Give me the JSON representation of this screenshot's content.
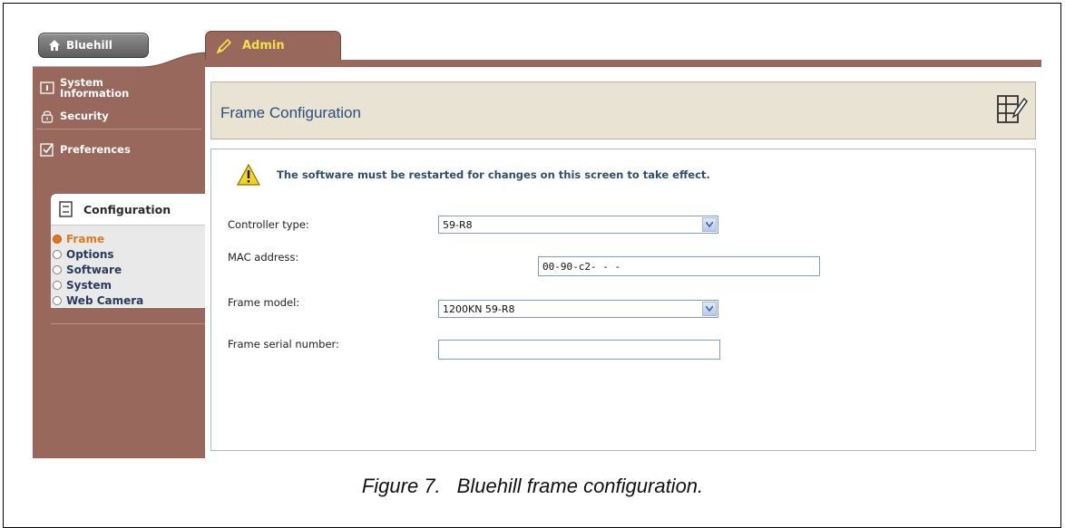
{
  "tabs": {
    "home_label": "Bluehill",
    "admin_label": "Admin"
  },
  "sidebar": {
    "items": [
      {
        "label_line1": "System",
        "label_line2": "Information",
        "icon": "info-icon"
      },
      {
        "label": "Security",
        "icon": "lock-icon"
      },
      {
        "label": "Preferences",
        "icon": "checkbox-icon"
      }
    ],
    "configuration": {
      "label": "Configuration",
      "icon": "configuration-icon",
      "subitems": [
        {
          "label": "Frame",
          "selected": true
        },
        {
          "label": "Options",
          "selected": false
        },
        {
          "label": "Software",
          "selected": false
        },
        {
          "label": "System",
          "selected": false
        },
        {
          "label": "Web Camera",
          "selected": false
        }
      ]
    }
  },
  "main": {
    "title": "Frame Configuration",
    "warning": "The software must be restarted for changes on this screen to take effect.",
    "fields": {
      "controller_type": {
        "label": "Controller type:",
        "value": "59-R8"
      },
      "mac_address": {
        "label": "MAC address:",
        "value": "00-90-c2-  -  -"
      },
      "frame_model": {
        "label": "Frame model:",
        "value": "1200KN 59-R8"
      },
      "frame_serial": {
        "label": "Frame serial number:",
        "value": ""
      }
    }
  },
  "caption": {
    "number": "Figure 7.",
    "text": "Bluehill frame configuration."
  },
  "colors": {
    "sidebar_brown": "#98685c",
    "admin_tab_text": "#f4e14a",
    "title_bar_bg": "#e8e3d3",
    "title_text": "#2a4f7f",
    "selected_subitem": "#e07a20"
  }
}
